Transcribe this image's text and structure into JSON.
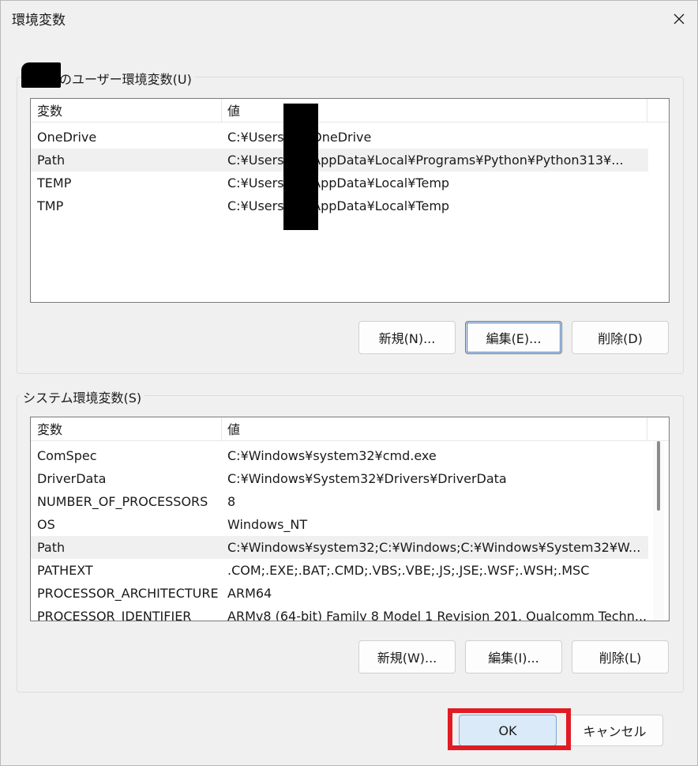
{
  "window": {
    "title": "環境変数",
    "close_symbol": "✕"
  },
  "user_section": {
    "legend": "のユーザー環境変数(U)",
    "columns": [
      "変数",
      "値"
    ],
    "rows": [
      {
        "name": "OneDrive",
        "value": "C:¥Users¥        n¥OneDrive"
      },
      {
        "name": "Path",
        "value": "C:¥Users¥        n¥AppData¥Local¥Programs¥Python¥Python313¥..."
      },
      {
        "name": "TEMP",
        "value": "C:¥Users¥        n¥AppData¥Local¥Temp"
      },
      {
        "name": "TMP",
        "value": "C:¥Users¥        n¥AppData¥Local¥Temp"
      }
    ],
    "buttons": {
      "new": "新規(N)...",
      "edit": "編集(E)...",
      "delete": "削除(D)"
    }
  },
  "system_section": {
    "legend": "システム環境変数(S)",
    "columns": [
      "変数",
      "値"
    ],
    "rows": [
      {
        "name": "ComSpec",
        "value": "C:¥Windows¥system32¥cmd.exe"
      },
      {
        "name": "DriverData",
        "value": "C:¥Windows¥System32¥Drivers¥DriverData"
      },
      {
        "name": "NUMBER_OF_PROCESSORS",
        "value": "8"
      },
      {
        "name": "OS",
        "value": "Windows_NT"
      },
      {
        "name": "Path",
        "value": "C:¥Windows¥system32;C:¥Windows;C:¥Windows¥System32¥W..."
      },
      {
        "name": "PATHEXT",
        "value": ".COM;.EXE;.BAT;.CMD;.VBS;.VBE;.JS;.JSE;.WSF;.WSH;.MSC"
      },
      {
        "name": "PROCESSOR_ARCHITECTURE",
        "value": "ARM64"
      },
      {
        "name": "PROCESSOR_IDENTIFIER",
        "value": "ARMv8 (64-bit) Family 8 Model 1 Revision 201, Qualcomm Techn..."
      }
    ],
    "buttons": {
      "new": "新規(W)...",
      "edit": "編集(I)...",
      "delete": "削除(L)"
    }
  },
  "footer": {
    "ok": "OK",
    "cancel": "キャンセル"
  },
  "colors": {
    "highlight": "#e01b24",
    "selected_row": "#f0f0f0",
    "ok_button": "#dbeaf8"
  }
}
